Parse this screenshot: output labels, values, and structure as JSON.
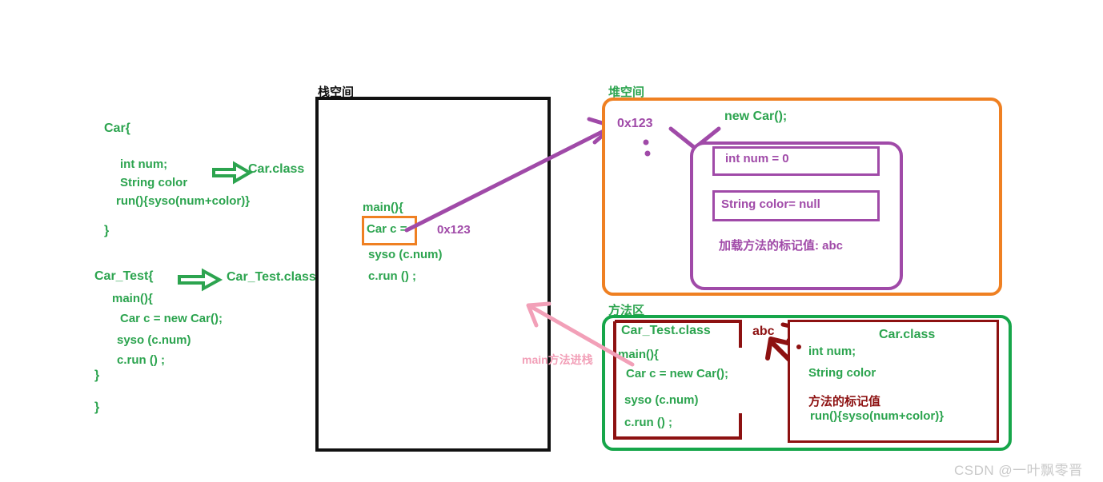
{
  "meta": {
    "watermark": "CSDN @一叶飘零晋"
  },
  "source_code": {
    "car_class": {
      "lines": [
        "Car{",
        "int num;",
        "String color",
        "run(){syso(num+color)}",
        "}"
      ],
      "compiled_name": "Car.class",
      "arrow": "green-arrow-right-icon"
    },
    "car_test_class": {
      "lines": [
        "Car_Test{",
        "main(){",
        "Car c = new Car();",
        "syso (c.num)",
        "c.run () ;",
        "}",
        "}"
      ],
      "compiled_name": "Car_Test.class",
      "arrow": "green-arrow-right-icon"
    }
  },
  "stack": {
    "title": "栈空间",
    "frame": {
      "header": "main(){",
      "var_decl": "Car  c  =",
      "var_value": "0x123",
      "lines": [
        "syso  (c.num)",
        "c.run  () ;"
      ]
    }
  },
  "heap": {
    "title": "堆空间",
    "address": "0x123",
    "new_expr": "new  Car();",
    "object": {
      "fields": [
        "int  num  = 0",
        "String color= null"
      ],
      "method_mark": "加载方法的标记值: abc"
    }
  },
  "method_area": {
    "title": "方法区",
    "car_test_class": {
      "name": "Car_Test.class",
      "lines": [
        "main(){",
        "Car  c  = new  Car();",
        "syso  (c.num)",
        "c.run  () ;"
      ]
    },
    "abc_marker": "abc",
    "car_class": {
      "name": "Car.class",
      "lines": [
        "int num;",
        "String color"
      ],
      "mark_label": "方法的标记值",
      "method_line": "run(){syso(num+color)}"
    }
  },
  "annotations": {
    "main_push_stack": "main方法进栈"
  },
  "colors": {
    "green": "#2ca44f",
    "stack_border": "#111111",
    "heap_border": "#ef8022",
    "method_border": "#16a64a",
    "purple": "#a04aa8",
    "dark_red": "#8d1111",
    "pink": "#f2a0b8",
    "watermark": "#c9c9c9"
  }
}
